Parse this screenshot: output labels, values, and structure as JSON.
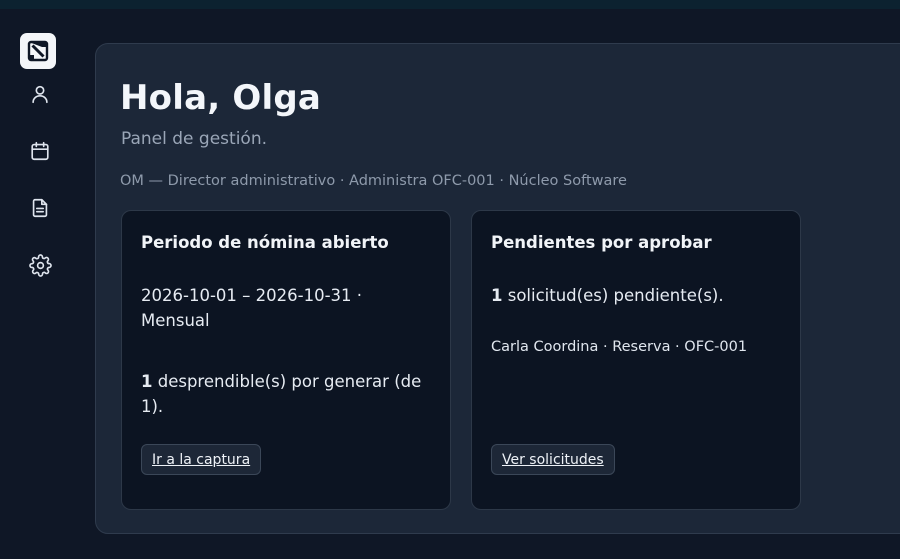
{
  "sidebar": {
    "items": [
      {
        "icon": "user-icon",
        "label": ""
      },
      {
        "icon": "calendar-icon",
        "label": ""
      },
      {
        "icon": "document-icon",
        "label": ""
      },
      {
        "icon": "gear-icon",
        "label": ""
      }
    ]
  },
  "header": {
    "greeting": "Hola, Olga",
    "subtitle": "Panel de gestión.",
    "context": "OM — Director administrativo · Administra OFC-001 · Núcleo Software"
  },
  "cards": {
    "payroll": {
      "title": "Periodo de nómina abierto",
      "period": "2026-10-01 – 2026-10-31 · Mensual",
      "count": "1",
      "count_text": " desprendible(s) por generar (de 1).",
      "button": "Ir a la captura"
    },
    "approvals": {
      "title": "Pendientes por aprobar",
      "count": "1",
      "count_text": " solicitud(es) pendiente(s).",
      "detail": "Carla Coordina · Reserva · OFC-001",
      "button": "Ver solicitudes"
    }
  },
  "colors": {
    "background": "#0f1726",
    "panel": "#1c2738",
    "card": "#0c1422",
    "text": "#e8edf5",
    "muted": "#9aa6b7"
  }
}
